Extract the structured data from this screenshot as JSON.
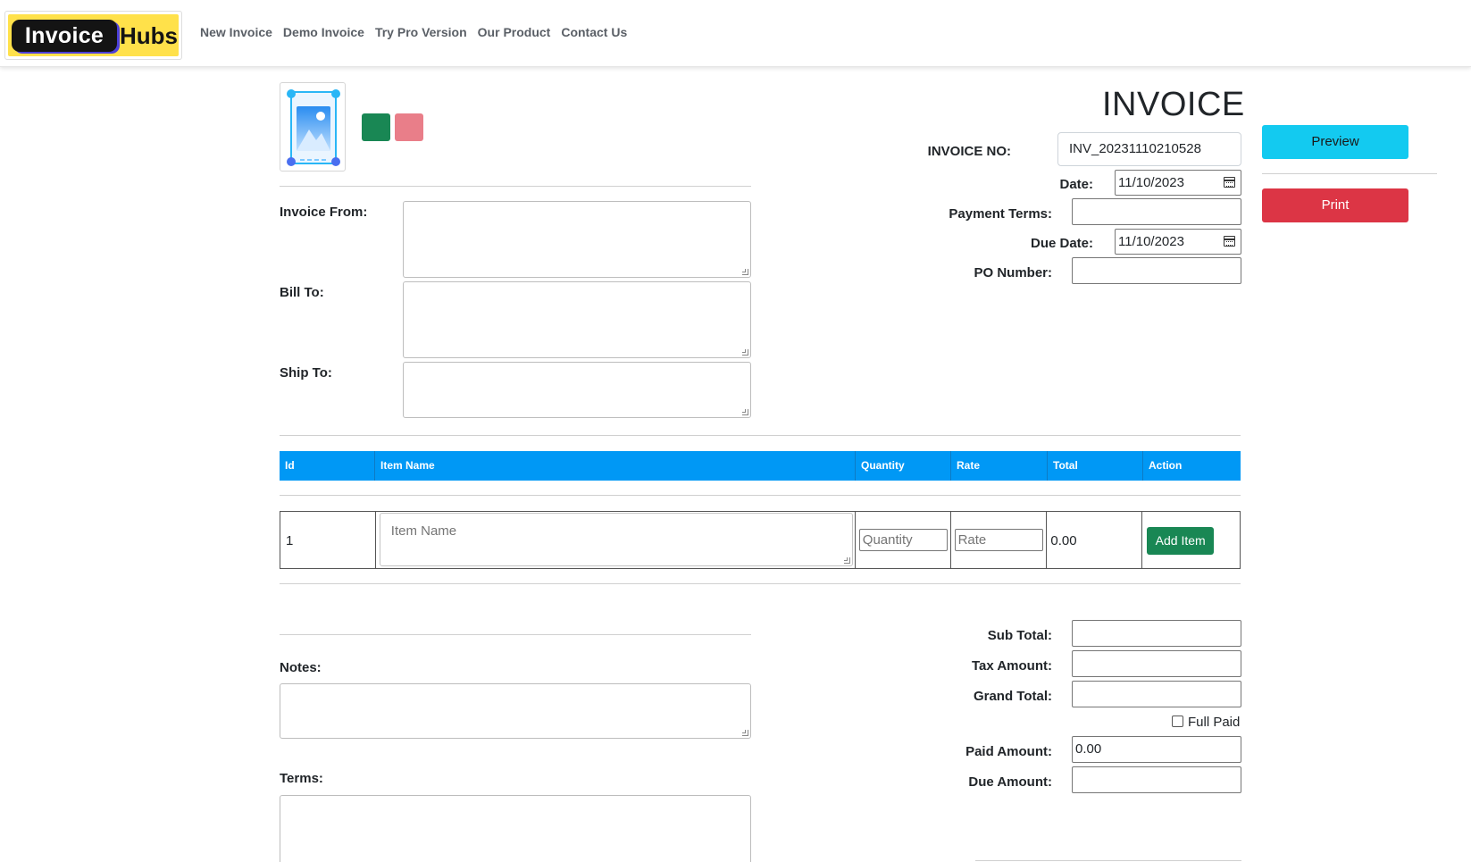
{
  "brand": {
    "logo_part1": "Invoice",
    "logo_part2": "Hubs"
  },
  "nav": {
    "items": [
      {
        "label": "New Invoice"
      },
      {
        "label": "Demo Invoice"
      },
      {
        "label": "Try Pro Version"
      },
      {
        "label": "Our Product"
      },
      {
        "label": "Contact Us"
      }
    ]
  },
  "header": {
    "title": "INVOICE",
    "swatches": [
      "#198754",
      "#e97e89"
    ],
    "upload_icon": "image-placeholder-icon"
  },
  "meta": {
    "invoice_no_label": "INVOICE NO:",
    "invoice_no_value": "INV_20231110210528",
    "date_label": "Date:",
    "date_value": "11/10/2023",
    "payment_terms_label": "Payment Terms:",
    "payment_terms_value": "",
    "due_date_label": "Due Date:",
    "due_date_value": "11/10/2023",
    "po_number_label": "PO Number:",
    "po_number_value": ""
  },
  "actions": {
    "preview_label": "Preview",
    "print_label": "Print"
  },
  "parties": {
    "from_label": "Invoice From:",
    "bill_to_label": "Bill To:",
    "ship_to_label": "Ship To:"
  },
  "table": {
    "headers": [
      "Id",
      "Item Name",
      "Quantity",
      "Rate",
      "Total",
      "Action"
    ],
    "rows": [
      {
        "id": "1",
        "item_name_placeholder": "Item Name",
        "quantity_placeholder": "Quantity",
        "rate_placeholder": "Rate",
        "total": "0.00",
        "action_label": "Add Item"
      }
    ]
  },
  "summary": {
    "sub_total_label": "Sub Total:",
    "tax_amount_label": "Tax Amount:",
    "grand_total_label": "Grand Total:",
    "full_paid_label": "Full Paid",
    "paid_amount_label": "Paid Amount:",
    "paid_amount_value": "0.00",
    "due_amount_label": "Due Amount:"
  },
  "footer_fields": {
    "notes_label": "Notes:",
    "terms_label": "Terms:"
  },
  "colors": {
    "table_header": "#0098f5",
    "preview_button": "#13caf0",
    "print_button": "#dc3545",
    "add_item_button": "#198754",
    "logo_background": "#ffe14a"
  }
}
